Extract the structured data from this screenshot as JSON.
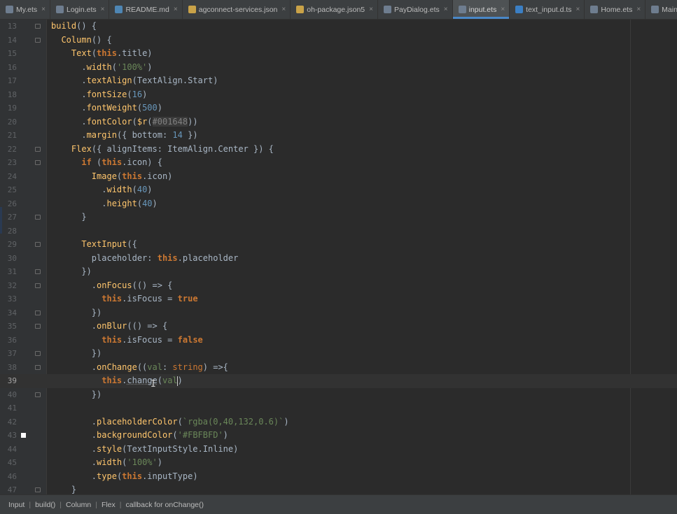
{
  "tabs": [
    {
      "label": "My.ets",
      "icon": "ets-file-icon",
      "active": false
    },
    {
      "label": "Login.ets",
      "icon": "ets-file-icon",
      "active": false
    },
    {
      "label": "README.md",
      "icon": "markdown-file-icon",
      "active": false
    },
    {
      "label": "agconnect-services.json",
      "icon": "json-file-icon",
      "active": false
    },
    {
      "label": "oh-package.json5",
      "icon": "json-file-icon",
      "active": false
    },
    {
      "label": "PayDialog.ets",
      "icon": "ets-file-icon",
      "active": false
    },
    {
      "label": "input.ets",
      "icon": "ets-file-icon",
      "active": true
    },
    {
      "label": "text_input.d.ts",
      "icon": "ts-file-icon",
      "active": false
    },
    {
      "label": "Home.ets",
      "icon": "ets-file-icon",
      "active": false
    },
    {
      "label": "MainPage.ets",
      "icon": "ets-file-icon",
      "active": false
    }
  ],
  "tab_close_glyph": "×",
  "current_line": "39",
  "lines": [
    {
      "n": "13",
      "html": "<span class=\"t-fn\">build</span>() {"
    },
    {
      "n": "14",
      "html": "  <span class=\"t-fn\">Column</span>() {"
    },
    {
      "n": "15",
      "html": "    <span class=\"t-fn\">Text</span>(<span class=\"t-kw\">this</span>.title)"
    },
    {
      "n": "16",
      "html": "      .<span class=\"t-fn\">width</span>(<span class=\"t-str\">'100%'</span>)"
    },
    {
      "n": "17",
      "html": "      .<span class=\"t-fn\">textAlign</span>(TextAlign.Start)"
    },
    {
      "n": "18",
      "html": "      .<span class=\"t-fn\">fontSize</span>(<span class=\"t-num\">16</span>)"
    },
    {
      "n": "19",
      "html": "      .<span class=\"t-fn\">fontWeight</span>(<span class=\"t-num\">500</span>)"
    },
    {
      "n": "20",
      "html": "      .<span class=\"t-fn\">fontColor</span>(<span class=\"t-fn\">$r</span>(<span class=\"t-res\">#001648</span>))"
    },
    {
      "n": "21",
      "html": "      .<span class=\"t-fn\">margin</span>({ bottom: <span class=\"t-num\">14</span> })"
    },
    {
      "n": "22",
      "html": "    <span class=\"t-fn\">Flex</span>({ alignItems: ItemAlign.Center }) {"
    },
    {
      "n": "23",
      "html": "      <span class=\"t-kw\">if</span> (<span class=\"t-kw\">this</span>.icon) {"
    },
    {
      "n": "24",
      "html": "        <span class=\"t-fn\">Image</span>(<span class=\"t-kw\">this</span>.icon)"
    },
    {
      "n": "25",
      "html": "          .<span class=\"t-fn\">width</span>(<span class=\"t-num\">40</span>)"
    },
    {
      "n": "26",
      "html": "          .<span class=\"t-fn\">height</span>(<span class=\"t-num\">40</span>)"
    },
    {
      "n": "27",
      "html": "      }"
    },
    {
      "n": "28",
      "html": ""
    },
    {
      "n": "29",
      "html": "      <span class=\"t-fn\">TextInput</span>({"
    },
    {
      "n": "30",
      "html": "        placeholder: <span class=\"t-kw\">this</span>.placeholder"
    },
    {
      "n": "31",
      "html": "      })"
    },
    {
      "n": "32",
      "html": "        .<span class=\"t-fn\">onFocus</span>(() => {"
    },
    {
      "n": "33",
      "html": "          <span class=\"t-kw\">this</span>.isFocus = <span class=\"t-kw\">true</span>"
    },
    {
      "n": "34",
      "html": "        })"
    },
    {
      "n": "35",
      "html": "        .<span class=\"t-fn\">onBlur</span>(() => {"
    },
    {
      "n": "36",
      "html": "          <span class=\"t-kw\">this</span>.isFocus = <span class=\"t-kw\">false</span>"
    },
    {
      "n": "37",
      "html": "        })"
    },
    {
      "n": "38",
      "html": "        .<span class=\"t-fn\">onChange</span>((<span class=\"t-param\">val</span>: <span class=\"t-type\">string</span>) =>{"
    },
    {
      "n": "39",
      "html": "          <span class=\"t-kw\">this</span>.<span class=\"t-call\">change</span>(<span class=\"t-param\">val</span><span class=\"cursor\"></span>)"
    },
    {
      "n": "40",
      "html": "        })"
    },
    {
      "n": "41",
      "html": ""
    },
    {
      "n": "42",
      "html": "        .<span class=\"t-fn\">placeholderColor</span>(<span class=\"t-str\">`rgba(0,40,132,0.6)`</span>)"
    },
    {
      "n": "43",
      "html": "        .<span class=\"t-fn\">backgroundColor</span>(<span class=\"t-str\">'#FBFBFD'</span>)"
    },
    {
      "n": "44",
      "html": "        .<span class=\"t-fn\">style</span>(TextInputStyle.Inline)"
    },
    {
      "n": "45",
      "html": "        .<span class=\"t-fn\">width</span>(<span class=\"t-str\">'100%'</span>)"
    },
    {
      "n": "46",
      "html": "        .<span class=\"t-fn\">type</span>(<span class=\"t-kw\">this</span>.inputType)"
    },
    {
      "n": "47",
      "html": "    }"
    }
  ],
  "breadcrumbs": [
    "Input",
    "build()",
    "Column",
    "Flex",
    "callback for onChange()"
  ],
  "colors": {
    "editor_bg": "#2b2b2b",
    "keyword": "#cc7832",
    "function": "#ffc66d",
    "string": "#6a8759",
    "number": "#6897bb",
    "text": "#a9b7c6",
    "param": "#6a8759",
    "active_tab_underline": "#4a88c7"
  }
}
